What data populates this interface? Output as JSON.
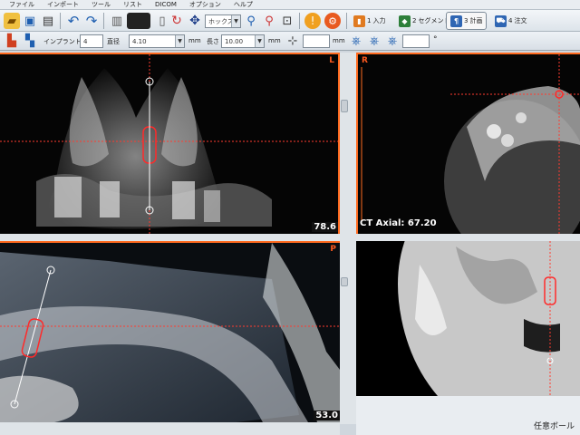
{
  "menu": [
    "ファイル",
    "インポート",
    "ツール",
    "リスト",
    "DICOM",
    "オプション",
    "ヘルプ"
  ],
  "toolbar": {
    "zoom_select": "ホックス",
    "steps": [
      {
        "num": "1",
        "label": "入力",
        "color": "#e07a20"
      },
      {
        "num": "2",
        "label": "セグメント",
        "color": "#2d7f3a"
      },
      {
        "num": "3",
        "label": "計画",
        "color": "#2f66b3"
      },
      {
        "num": "4",
        "label": "注文",
        "color": "#2f66b3"
      }
    ],
    "active_step": "3"
  },
  "implant": {
    "implant_label": "インプラント",
    "implant_value": "4",
    "diameter_label": "直径",
    "diameter_value": "4.10",
    "diameter_unit": "mm",
    "length_label": "長さ",
    "length_value": "10.00",
    "length_unit": "mm",
    "extra_unit": "mm"
  },
  "views": {
    "top_left": {
      "orientation": "L",
      "value": "78.6"
    },
    "top_right": {
      "orientation": "R",
      "title": "CT Axial: 67.20"
    },
    "bottom_left": {
      "orientation": "P",
      "value": "53.0"
    },
    "bottom_right": {}
  },
  "status": {
    "text": "任意ボール"
  },
  "colors": {
    "accent": "#ff6a1f",
    "guide": "#ff3b2f",
    "implant": "#ff2a2a"
  }
}
